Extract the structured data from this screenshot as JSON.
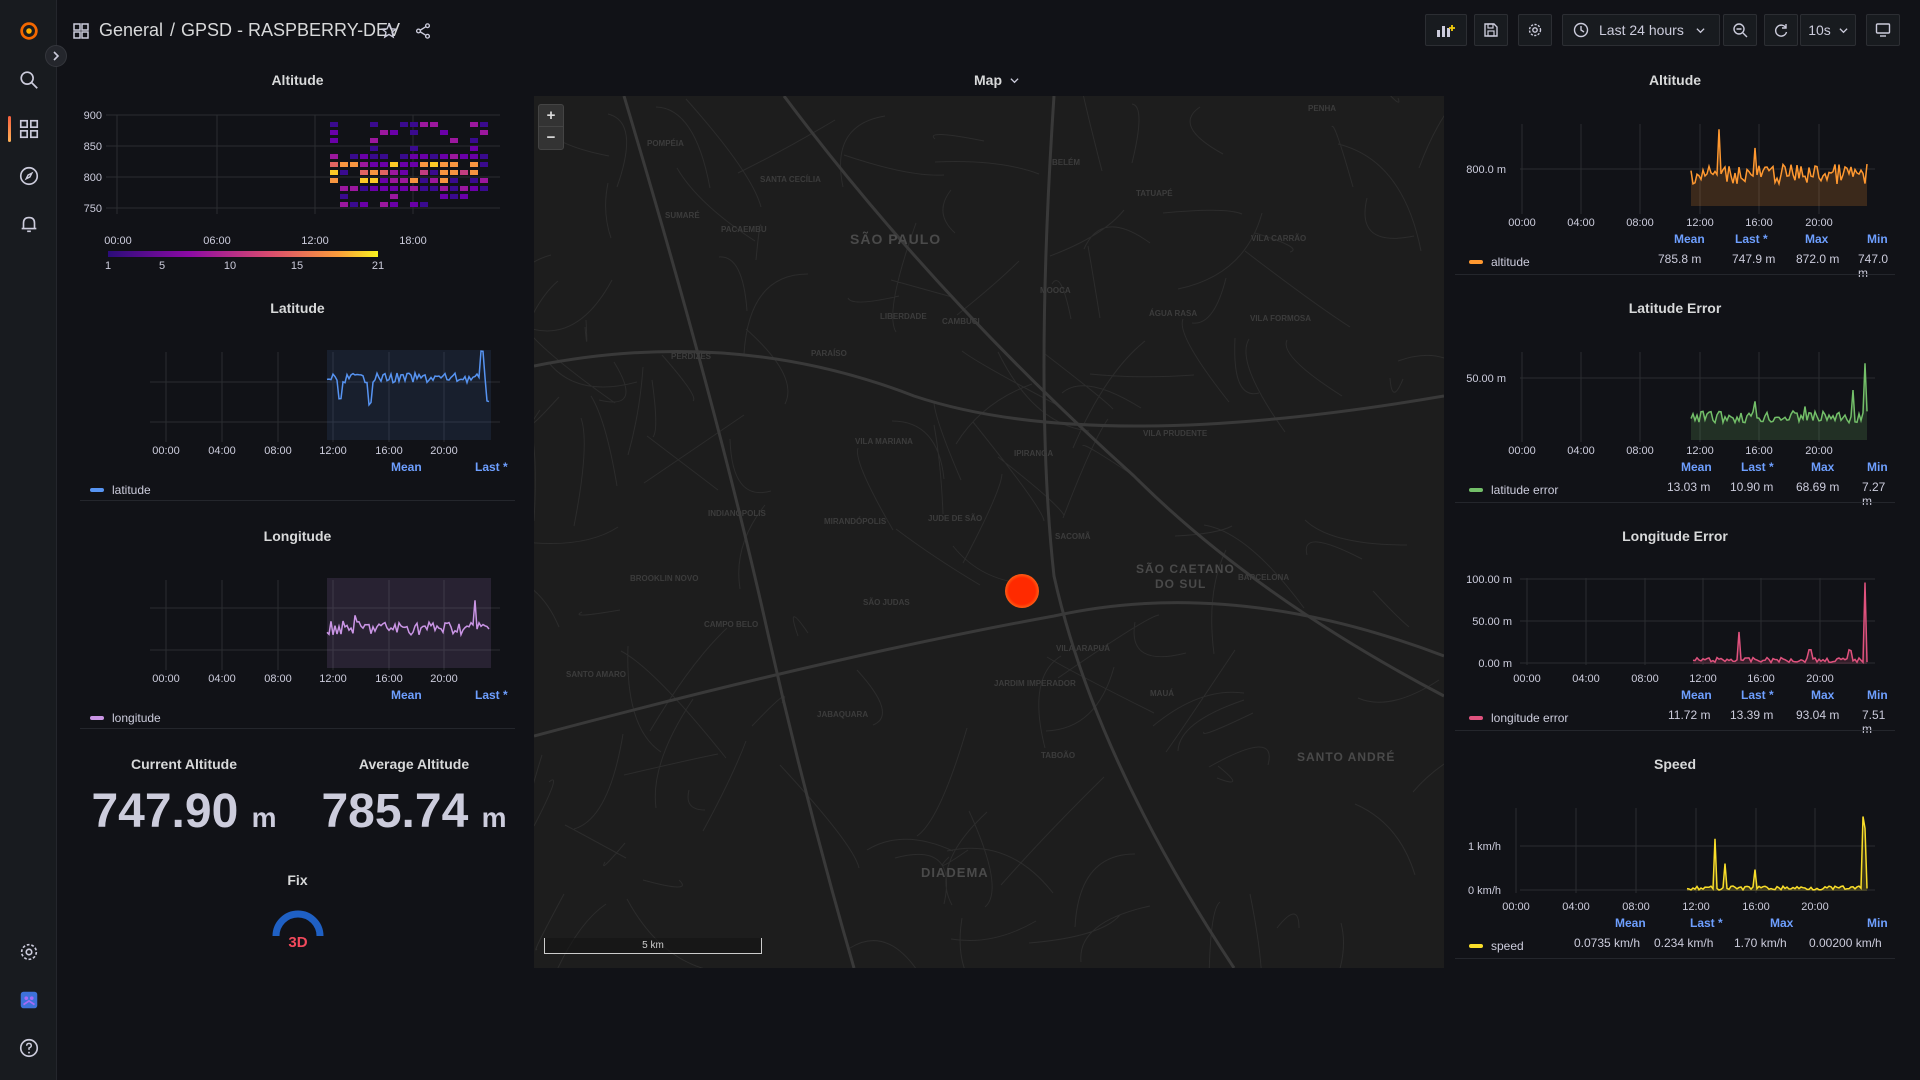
{
  "topbar": {
    "crumb_section": "General",
    "crumb_sep": "/",
    "crumb_dashboard": "GPSD - RASPBERRY-DEV",
    "time_range": "Last 24 hours",
    "refresh_interval": "10s"
  },
  "panels": {
    "altitude_heatmap": {
      "title": "Altitude",
      "y_ticks": [
        "900",
        "850",
        "800",
        "750"
      ],
      "x_ticks": [
        "00:00",
        "06:00",
        "12:00",
        "18:00"
      ],
      "scale_ticks": [
        "1",
        "5",
        "10",
        "15",
        "21"
      ]
    },
    "latitude": {
      "title": "Latitude",
      "x_ticks": [
        "00:00",
        "04:00",
        "08:00",
        "12:00",
        "16:00",
        "20:00"
      ],
      "legend_headers": [
        "Mean",
        "Last *"
      ],
      "series": "latitude",
      "color": "#5794f2"
    },
    "longitude": {
      "title": "Longitude",
      "x_ticks": [
        "00:00",
        "04:00",
        "08:00",
        "12:00",
        "16:00",
        "20:00"
      ],
      "legend_headers": [
        "Mean",
        "Last *"
      ],
      "series": "longitude",
      "color": "#ca95e5"
    },
    "current_altitude": {
      "title": "Current Altitude",
      "value": "747.90",
      "unit": "m"
    },
    "average_altitude": {
      "title": "Average Altitude",
      "value": "785.74",
      "unit": "m"
    },
    "fix": {
      "title": "Fix",
      "value": "3D"
    },
    "map": {
      "title": "Map",
      "zoom_in": "+",
      "zoom_out": "−",
      "scale_label": "5 km",
      "cities": [
        "SÃO PAULO",
        "SÃO CAETANO",
        "DO SUL",
        "SANTO ANDRÉ",
        "DIADEMA"
      ],
      "districts": [
        "PENHA",
        "VILA CARRÃO",
        "MOOCA",
        "IPIRANGA",
        "SACOMÃ",
        "VILA MARIANA",
        "CAMPO BELO",
        "SANTO AMARO",
        "JABAQUARA",
        "LIBERDADE",
        "CAMBUCI",
        "PARAÍSO",
        "BELÉM",
        "TATUAPÉ",
        "VILA PRUDENTE",
        "SÃO JUDAS",
        "JARDIM IMPERADOR",
        "VILA ARAPUÁ",
        "TABOÃO",
        "MAUÁ",
        "BARCELONA",
        "VILA FORMOSA",
        "ÁGUA RASA",
        "PACAEMBU",
        "POMPÉIA",
        "SANTA CECÍLIA",
        "SUMARÉ",
        "PERDIZES",
        "BROOKLIN NOVO",
        "INDIANÓPOLIS",
        "MIRANDÓPOLIS",
        "JUDE DE SÃO"
      ]
    },
    "altitude_ts": {
      "title": "Altitude",
      "y_ticks": [
        "800.0 m"
      ],
      "x_ticks": [
        "00:00",
        "04:00",
        "08:00",
        "12:00",
        "16:00",
        "20:00"
      ],
      "legend_headers": [
        "Mean",
        "Last *",
        "Max",
        "Min"
      ],
      "series": "altitude",
      "color": "#ff9830",
      "values": [
        "785.8 m",
        "747.9 m",
        "872.0 m",
        "747.0 m"
      ]
    },
    "latitude_error": {
      "title": "Latitude Error",
      "y_ticks": [
        "50.00 m"
      ],
      "x_ticks": [
        "00:00",
        "04:00",
        "08:00",
        "12:00",
        "16:00",
        "20:00"
      ],
      "legend_headers": [
        "Mean",
        "Last *",
        "Max",
        "Min"
      ],
      "series": "latitude error",
      "color": "#73bf69",
      "values": [
        "13.03 m",
        "10.90 m",
        "68.69 m",
        "7.27 m"
      ]
    },
    "longitude_error": {
      "title": "Longitude Error",
      "y_ticks": [
        "100.00 m",
        "50.00 m",
        "0.00 m"
      ],
      "x_ticks": [
        "00:00",
        "04:00",
        "08:00",
        "12:00",
        "16:00",
        "20:00"
      ],
      "legend_headers": [
        "Mean",
        "Last *",
        "Max",
        "Min"
      ],
      "series": "longitude error",
      "color": "#e0527e",
      "values": [
        "11.72 m",
        "13.39 m",
        "93.04 m",
        "7.51 m"
      ]
    },
    "speed": {
      "title": "Speed",
      "y_ticks": [
        "1 km/h",
        "0 km/h"
      ],
      "x_ticks": [
        "00:00",
        "04:00",
        "08:00",
        "12:00",
        "16:00",
        "20:00"
      ],
      "legend_headers": [
        "Mean",
        "Last *",
        "Max",
        "Min"
      ],
      "series": "speed",
      "color": "#fade2a",
      "values": [
        "0.0735 km/h",
        "0.234 km/h",
        "1.70 km/h",
        "0.00200 km/h"
      ]
    }
  }
}
